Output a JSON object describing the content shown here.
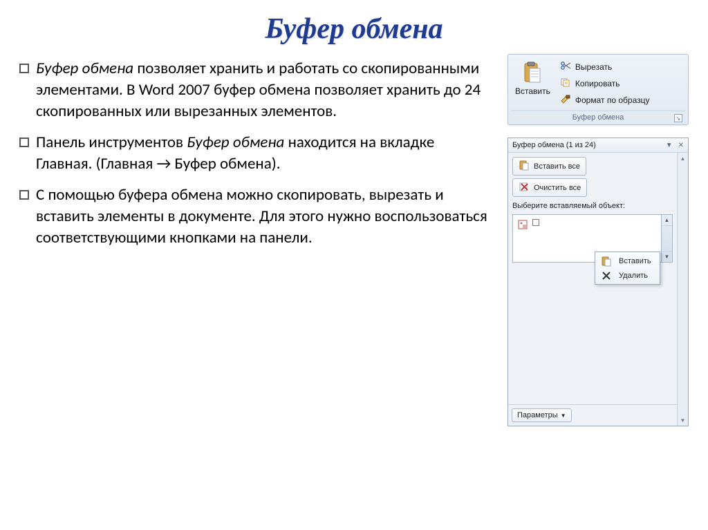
{
  "title": "Буфер обмена",
  "bullets": [
    {
      "prefix_italic": "Буфер обмена ",
      "rest": "позволяет хранить и работать со скопированными элементами. В Word 2007 буфер обмена позволяет хранить до 24 скопированных или вырезанных элементов."
    },
    {
      "prefix": "Панель инструментов ",
      "italic_mid": "Буфер обмена ",
      "rest": "находится на вкладке Главная.  (Главная → Буфер обмена)."
    },
    {
      "plain": "С помощью буфера обмена можно скопировать, вырезать и вставить элементы в документе. Для этого нужно воспользоваться соответствующими кнопками на панели."
    }
  ],
  "ribbon": {
    "paste": "Вставить",
    "cut": "Вырезать",
    "copy": "Копировать",
    "format_painter": "Формат по образцу",
    "group_title": "Буфер обмена"
  },
  "pane": {
    "header": "Буфер обмена (1 из 24)",
    "paste_all": "Вставить все",
    "clear_all": "Очистить все",
    "select_label": "Выберите вставляемый объект:",
    "context_paste": "Вставить",
    "context_delete": "Удалить",
    "params": "Параметры"
  }
}
